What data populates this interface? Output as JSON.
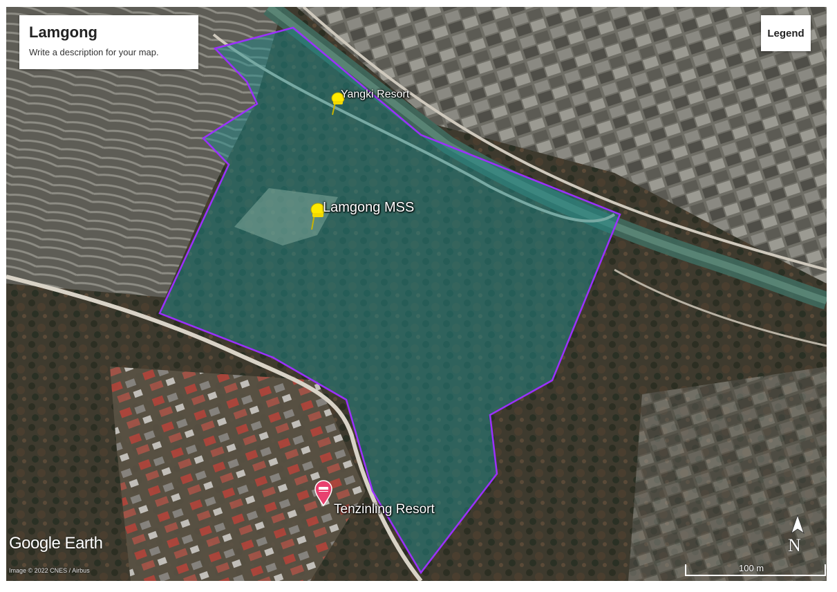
{
  "map": {
    "title": "Lamgong",
    "description": "Write a description for your map.",
    "legend_label": "Legend",
    "brand": "Google Earth",
    "credit": "Image © 2022 CNES / Airbus",
    "scale_label": "100 m",
    "north_label": "N",
    "boundary_color": "#9b30ff",
    "fill_color": "#1f8a8a"
  },
  "placemarks": [
    {
      "name": "Yangki Resort",
      "icon": "yellow-pushpin-icon"
    },
    {
      "name": "Lamgong MSS",
      "icon": "yellow-pushpin-icon"
    },
    {
      "name": "Tenzinling Resort",
      "icon": "pink-lodging-marker-icon"
    }
  ]
}
